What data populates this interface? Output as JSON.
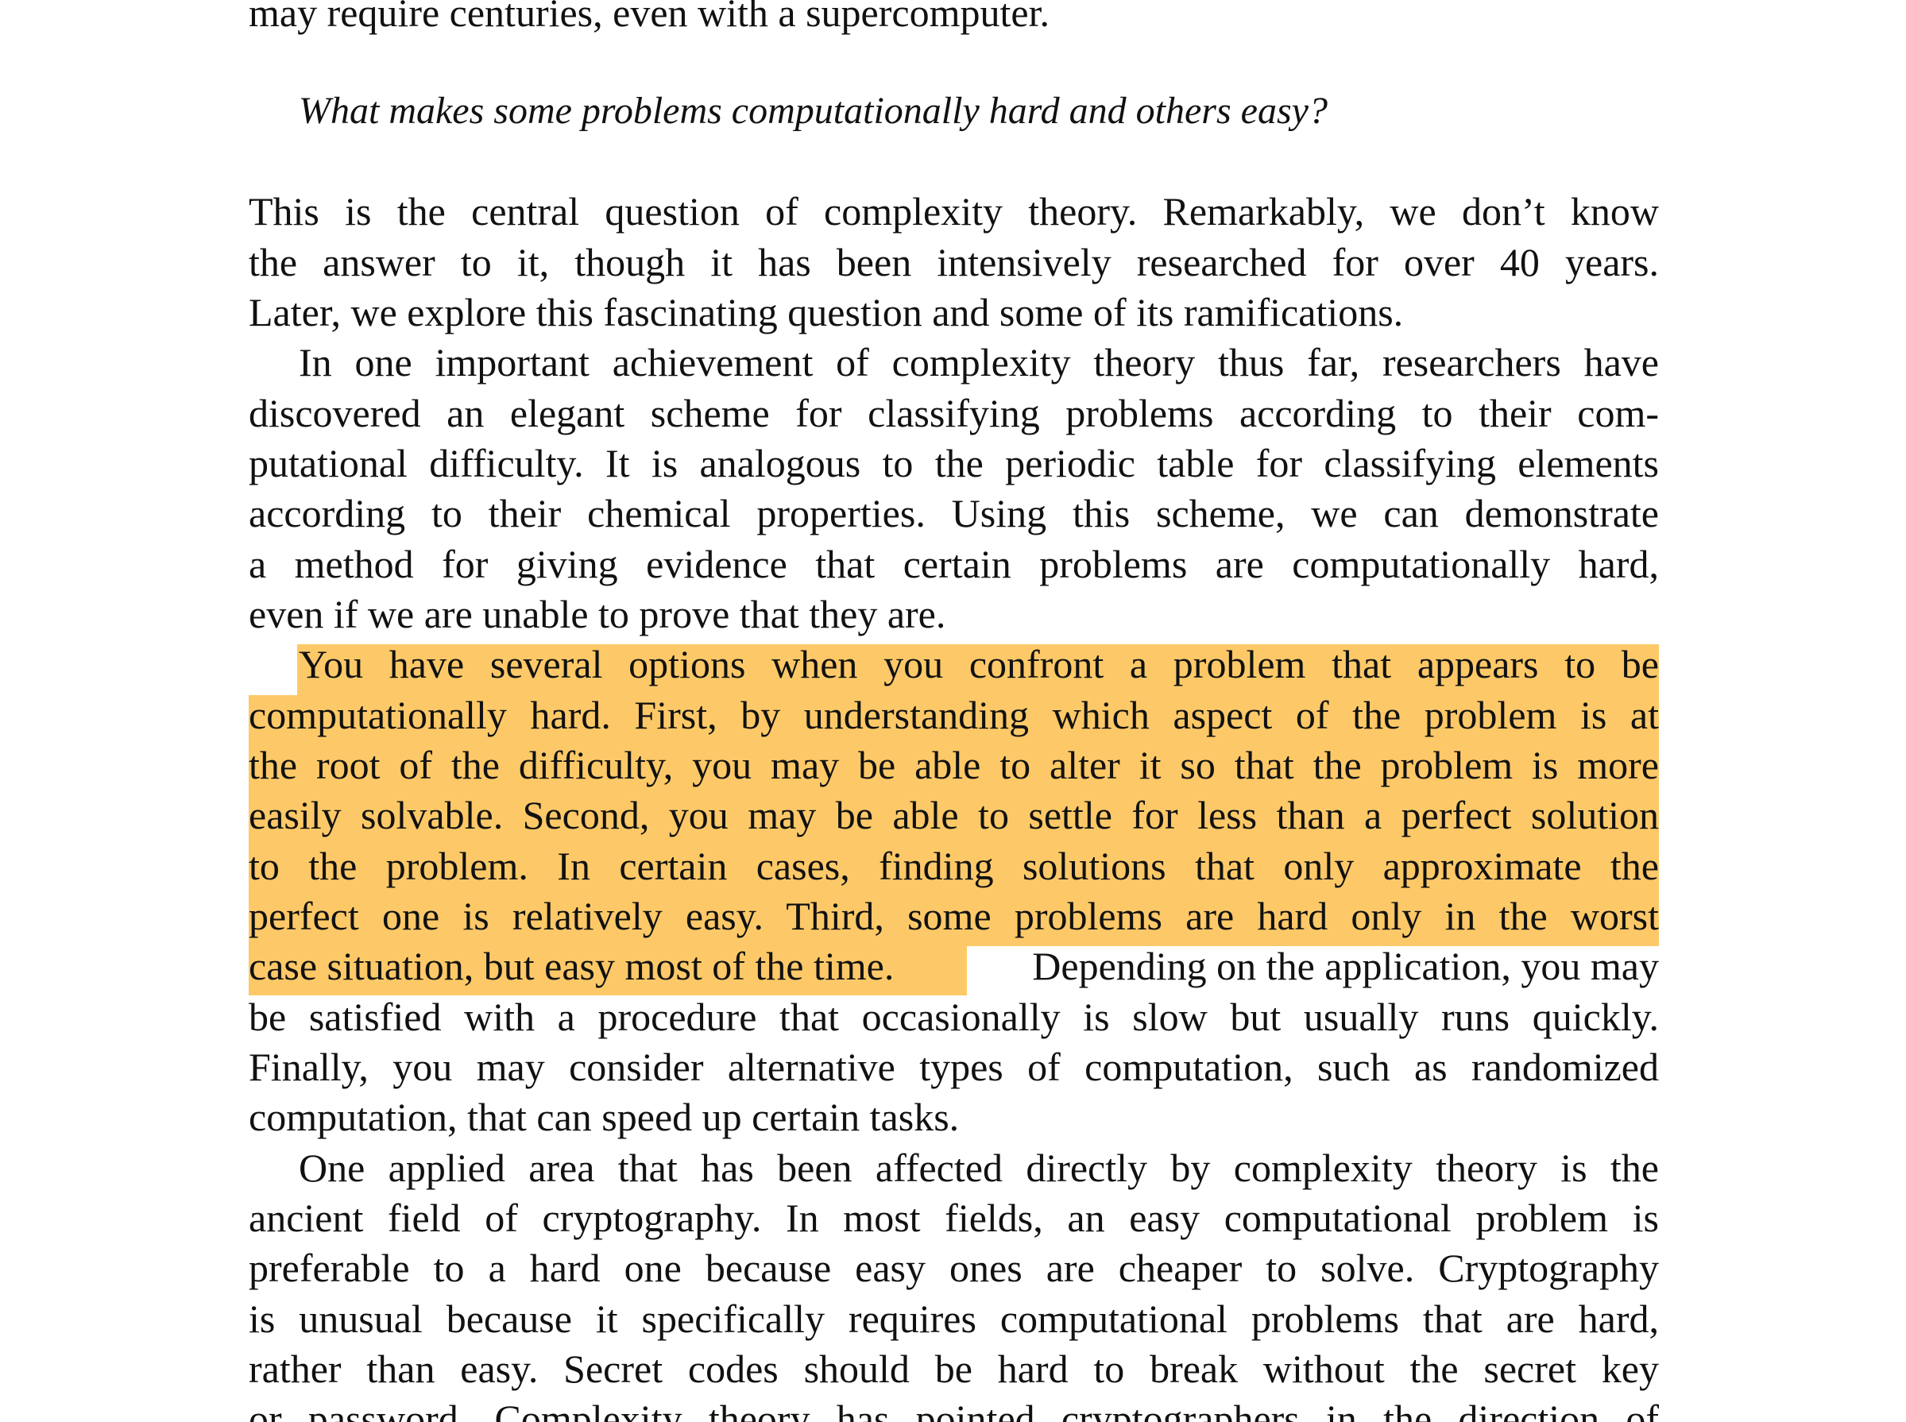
{
  "document": {
    "top_fragment": "may require centuries, even with a supercomputer.",
    "question": "What makes some problems computationally hard and others easy?",
    "paragraphs": [
      {
        "lines": [
          "This is the central question of complexity theory. Remarkably, we don’t know",
          "the answer to it, though it has been intensively researched for over 40 years.",
          "Later, we explore this fascinating question and some of its ramifications."
        ]
      },
      {
        "lines": [
          "In one important achievement of complexity theory thus far, researchers have",
          "discovered an elegant scheme for classifying problems according to their com-",
          "putational difficulty. It is analogous to the periodic table for classifying elements",
          "according to their chemical properties. Using this scheme, we can demonstrate",
          "a method for giving evidence that certain problems are computationally hard,",
          "even if we are unable to prove that they are."
        ]
      },
      {
        "lines": [
          "You have several options when you confront a problem that appears to be",
          "computationally hard. First, by understanding which aspect of the problem is at",
          "the root of the difficulty, you may be able to alter it so that the problem is more",
          "easily solvable. Second, you may be able to settle for less than a perfect solution",
          "to the problem. In certain cases, finding solutions that only approximate the",
          "perfect one is relatively easy. Third, some problems are hard only in the worst"
        ],
        "split_line": {
          "highlighted": "case situation, but easy most of the time.",
          "plain": "Depending on the application, you may"
        },
        "rest_lines": [
          "be satisfied with a procedure that occasionally is slow but usually runs quickly.",
          "Finally, you may consider alternative types of computation, such as randomized",
          "computation, that can speed up certain tasks."
        ]
      },
      {
        "lines": [
          "One applied area that has been affected directly by complexity theory is the",
          "ancient field of cryptography. In most fields, an easy computational problem is",
          "preferable to a hard one because easy ones are cheaper to solve. Cryptography",
          "is unusual because it specifically requires computational problems that are hard,",
          "rather than easy. Secret codes should be hard to break without the secret key",
          "or password. Complexity theory has pointed cryptographers in the direction of"
        ]
      }
    ]
  },
  "highlight_color": "#fdc968"
}
